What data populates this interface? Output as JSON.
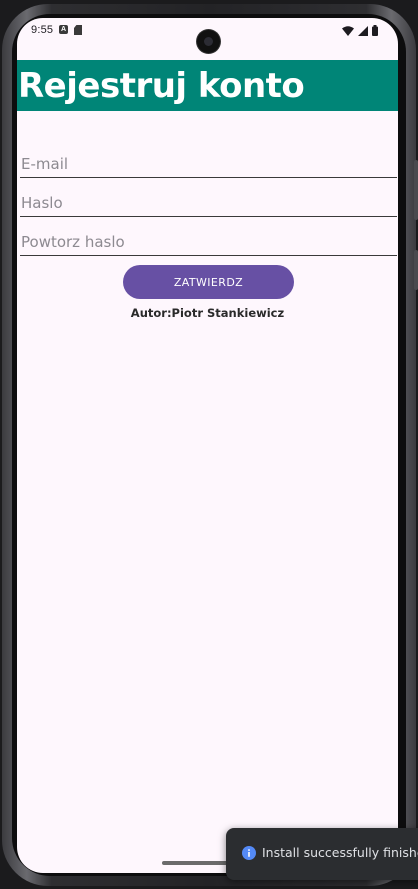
{
  "status_bar": {
    "time": "9:55",
    "notification_a": "A"
  },
  "app_bar": {
    "title": "Rejestruj konto",
    "color": "#008577"
  },
  "form": {
    "email_placeholder": "E-mail",
    "password_placeholder": "Haslo",
    "repeat_password_placeholder": "Powtorz haslo",
    "submit_label": "ZATWIERDZ",
    "author": "Autor:Piotr Stankiewicz",
    "button_color": "#6750a4"
  },
  "toast": {
    "icon": "info-icon",
    "message": "Install successfully finished"
  }
}
